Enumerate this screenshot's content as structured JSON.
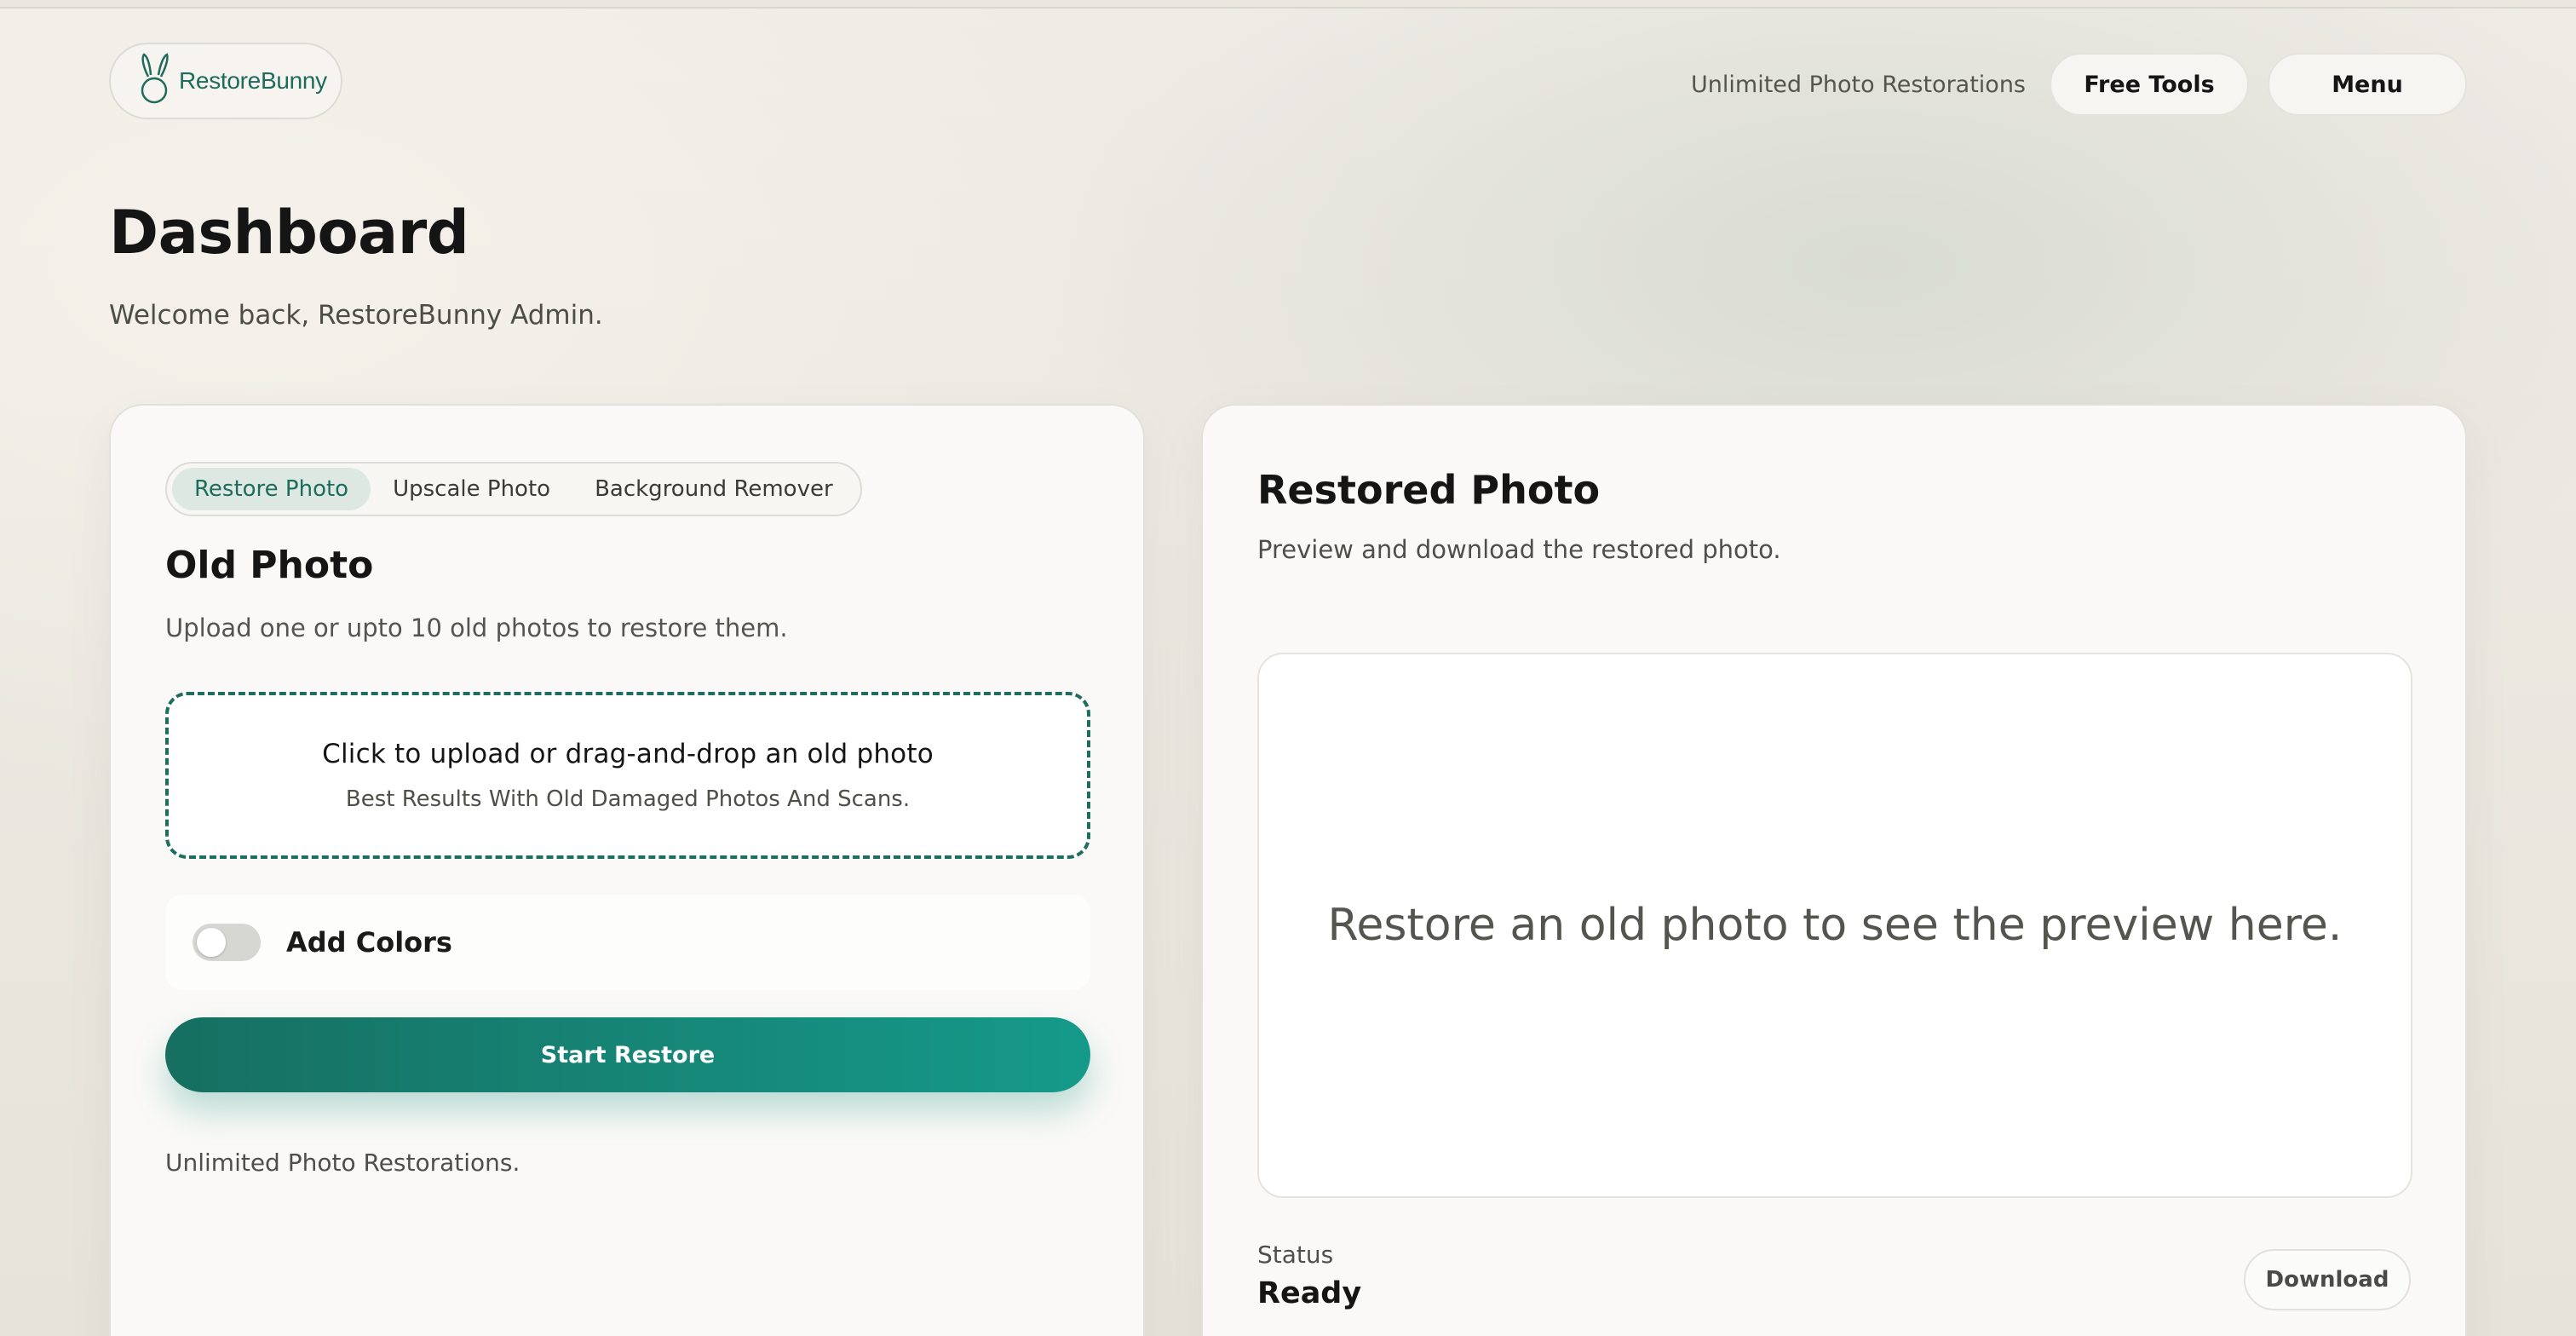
{
  "header": {
    "logo_text": "RestoreBunny",
    "note": "Unlimited Photo Restorations",
    "free_tools_label": "Free Tools",
    "menu_label": "Menu"
  },
  "page": {
    "title": "Dashboard",
    "subtitle": "Welcome back, RestoreBunny Admin."
  },
  "left_card": {
    "tabs": [
      {
        "label": "Restore Photo",
        "active": true
      },
      {
        "label": "Upscale Photo",
        "active": false
      },
      {
        "label": "Background Remover",
        "active": false
      }
    ],
    "title": "Old Photo",
    "subtitle": "Upload one or upto 10 old photos to restore them.",
    "dropzone": {
      "main": "Click to upload or drag-and-drop an old photo",
      "sub": "Best Results With Old Damaged Photos And Scans."
    },
    "toggle": {
      "label": "Add Colors",
      "on": false
    },
    "start_label": "Start Restore",
    "footnote": "Unlimited Photo Restorations."
  },
  "right_card": {
    "title": "Restored Photo",
    "subtitle": "Preview and download the restored photo.",
    "preview_placeholder": "Restore an old photo to see the preview here.",
    "status_label": "Status",
    "status_value": "Ready",
    "download_label": "Download"
  },
  "colors": {
    "brand": "#1d6e5e",
    "accent_start": "#166f61",
    "accent_end": "#159a8a"
  },
  "icons": {
    "logo": "bunny-icon"
  }
}
